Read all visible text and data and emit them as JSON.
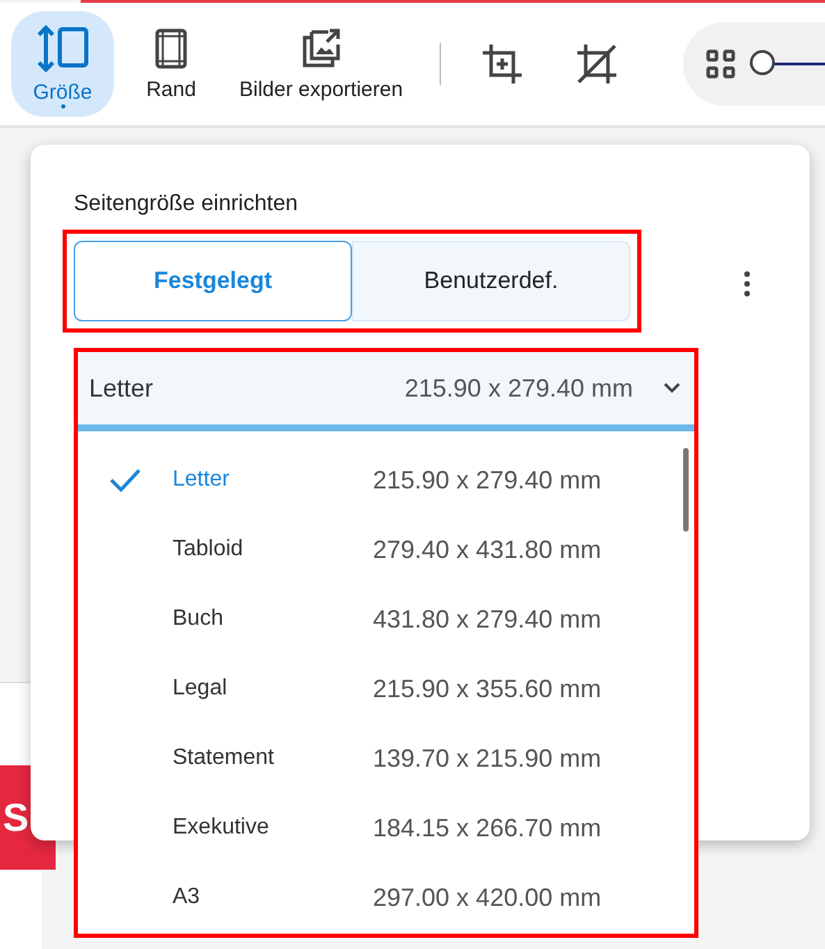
{
  "toolbar": {
    "items": [
      {
        "kind": "tool",
        "label": "Größe",
        "selected": true
      },
      {
        "kind": "tool",
        "label": "Rand",
        "selected": false
      },
      {
        "kind": "tool",
        "label": "Bilder exportieren",
        "selected": false
      },
      {
        "kind": "divider"
      },
      {
        "kind": "icon"
      },
      {
        "kind": "icon"
      }
    ],
    "zoom": {
      "level": 0
    }
  },
  "background": {
    "badge_letter": "S"
  },
  "popup": {
    "title": "Seitengröße einrichten",
    "modes_highlighted": true,
    "modes": [
      {
        "label": "Festgelegt",
        "selected": true
      },
      {
        "label": "Benutzerdef.",
        "selected": false
      }
    ],
    "dropdown": {
      "highlighted": true,
      "expanded": true,
      "value": "Letter",
      "size": "215.90 x 279.40 mm",
      "options": [
        {
          "name": "Letter",
          "size": "215.90 x 279.40 mm",
          "selected": true
        },
        {
          "name": "Tabloid",
          "size": "279.40 x 431.80 mm",
          "selected": false
        },
        {
          "name": "Buch",
          "size": "431.80 x 279.40 mm",
          "selected": false
        },
        {
          "name": "Legal",
          "size": "215.90 x 355.60 mm",
          "selected": false
        },
        {
          "name": "Statement",
          "size": "139.70 x 215.90 mm",
          "selected": false
        },
        {
          "name": "Exekutive",
          "size": "184.15 x 266.70 mm",
          "selected": false
        },
        {
          "name": "A3",
          "size": "297.00 x 420.00 mm",
          "selected": false
        }
      ]
    }
  }
}
